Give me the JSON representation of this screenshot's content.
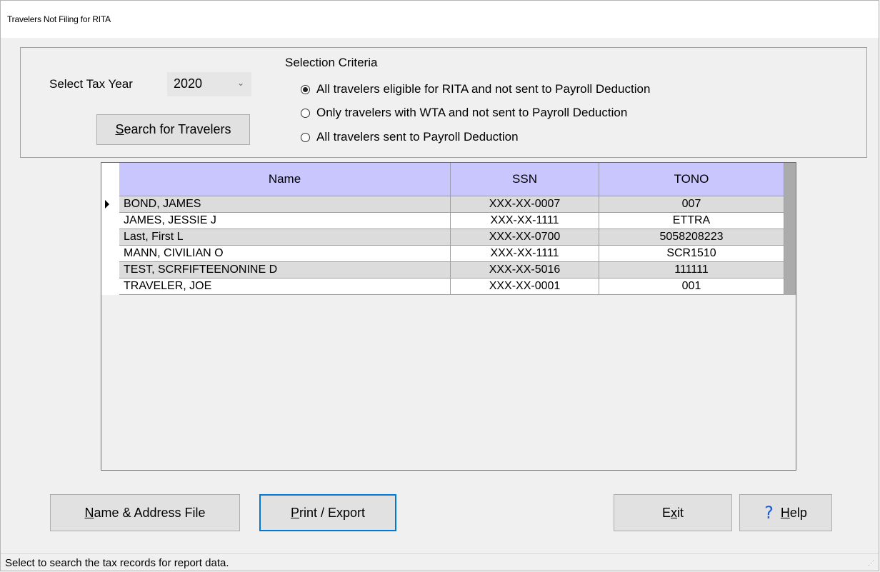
{
  "window": {
    "title": "Travelers Not Filing for RITA"
  },
  "criteria": {
    "tax_year_label": "Select Tax Year",
    "tax_year_value": "2020",
    "search_button_prefix": "",
    "search_button_mnemonic": "S",
    "search_button_rest": "earch for Travelers",
    "selection_label": "Selection Criteria",
    "options": [
      {
        "label": "All travelers eligible for RITA and not sent to Payroll Deduction",
        "checked": true
      },
      {
        "label": "Only travelers with WTA and not sent to Payroll Deduction",
        "checked": false
      },
      {
        "label": "All travelers sent to Payroll Deduction",
        "checked": false
      }
    ]
  },
  "grid": {
    "columns": [
      "Name",
      "SSN",
      "TONO"
    ],
    "rows": [
      {
        "name": "BOND, JAMES",
        "ssn": "XXX-XX-0007",
        "tono": "007"
      },
      {
        "name": "JAMES, JESSIE J",
        "ssn": "XXX-XX-1111",
        "tono": "ETTRA"
      },
      {
        "name": "Last, First L",
        "ssn": "XXX-XX-0700",
        "tono": "5058208223"
      },
      {
        "name": "MANN, CIVILIAN O",
        "ssn": "XXX-XX-1111",
        "tono": "SCR1510"
      },
      {
        "name": "TEST, SCRFIFTEENONINE D",
        "ssn": "XXX-XX-5016",
        "tono": "111111"
      },
      {
        "name": "TRAVELER, JOE",
        "ssn": "XXX-XX-0001",
        "tono": "001"
      }
    ]
  },
  "buttons": {
    "name_address_mnemonic": "N",
    "name_address_rest": "ame & Address File",
    "print_mnemonic": "P",
    "print_rest": "rint / Export",
    "exit_prefix": "E",
    "exit_mnemonic": "x",
    "exit_rest": "it",
    "help_mnemonic": "H",
    "help_rest": "elp"
  },
  "status": {
    "text": "Select to search the tax records for report data."
  },
  "icons": {
    "help": "question-mark-icon",
    "dropdown": "chevron-down-icon",
    "row_selector": "row-pointer-icon",
    "size_grip": "size-grip-icon"
  },
  "colors": {
    "header_bg": "#c8c6fc",
    "alt_row_bg": "#dcdcdc",
    "focus_border": "#0078d7",
    "help_icon": "#1a5ad7"
  }
}
